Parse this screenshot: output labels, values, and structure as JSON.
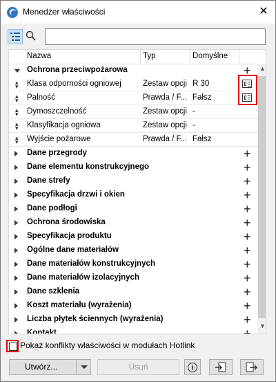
{
  "window": {
    "title": "Menedżer właściwości",
    "close_glyph": "✕"
  },
  "toolbar": {
    "search_placeholder": "",
    "search_value": ""
  },
  "table": {
    "columns": {
      "name": "Nazwa",
      "type": "Typ",
      "default": "Domyślne"
    },
    "rows": [
      {
        "kind": "group-open",
        "name": "Ochrona przeciwpożarowa",
        "type": "",
        "default": ""
      },
      {
        "kind": "prop",
        "name": "Klasa odporności ogniowej",
        "type": "Zestaw opcji",
        "default": "R 30",
        "icon": "property-sheet-icon"
      },
      {
        "kind": "prop",
        "name": "Palność",
        "type": "Prawda / F...",
        "default": "Fałsz",
        "icon": "property-sheet-icon"
      },
      {
        "kind": "prop",
        "name": "Dymoszczelność",
        "type": "Zestaw opcji",
        "default": "-"
      },
      {
        "kind": "prop",
        "name": "Klasyfikacja ogniowa",
        "type": "Zestaw opcji",
        "default": "-"
      },
      {
        "kind": "prop",
        "name": "Wyjście pożarowe",
        "type": "Prawda / F...",
        "default": "Fałsz"
      },
      {
        "kind": "group",
        "name": "Dane przegrody"
      },
      {
        "kind": "group",
        "name": "Dane elementu konstrukcyjnego"
      },
      {
        "kind": "group",
        "name": "Dane strefy"
      },
      {
        "kind": "group",
        "name": "Specyfikacja drzwi i okien"
      },
      {
        "kind": "group",
        "name": "Dane podłogi"
      },
      {
        "kind": "group",
        "name": "Ochrona środowiska"
      },
      {
        "kind": "group",
        "name": "Specyfikacja produktu"
      },
      {
        "kind": "group",
        "name": "Ogólne dane materiałów"
      },
      {
        "kind": "group",
        "name": "Dane materiałów konstrukcyjnych"
      },
      {
        "kind": "group",
        "name": "Dane materiałów izolacyjnych"
      },
      {
        "kind": "group",
        "name": "Dane szklenia"
      },
      {
        "kind": "group",
        "name": "Koszt materiału (wyrażenia)"
      },
      {
        "kind": "group",
        "name": "Liczba płytek ściennych (wyrażenia)"
      },
      {
        "kind": "group",
        "name": "Kontakt"
      }
    ]
  },
  "checkbox": {
    "label": "Pokaż konflikty właściwości w modułach Hotlink",
    "checked": false
  },
  "buttons": {
    "create": "Utwórz...",
    "delete": "Usuń",
    "info": "i"
  },
  "colors": {
    "highlight": "#e00000",
    "selected_toolbar": "#cfe3f7"
  }
}
